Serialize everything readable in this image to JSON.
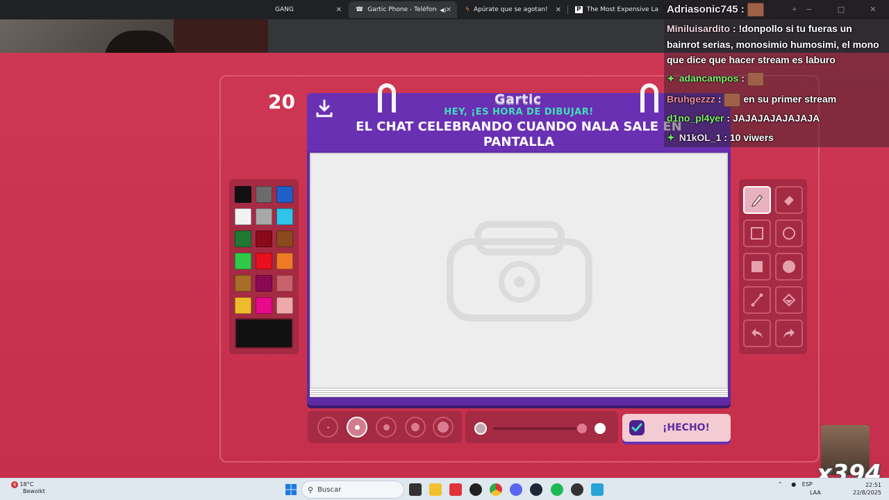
{
  "browser": {
    "tabs": [
      {
        "label": "GANG",
        "icon": "tab-favicon"
      },
      {
        "label": "Gartic Phone - Teléfono De",
        "icon": "phone-icon",
        "audio": true
      },
      {
        "label": "Apúrate que se agotan!",
        "icon": "lightning-icon"
      },
      {
        "label": "The Most Expensive Labubu Di",
        "icon": "p-icon"
      }
    ],
    "new_tab": "+",
    "window": {
      "minimize": "−",
      "maximize": "□",
      "close": "✕"
    }
  },
  "game": {
    "timer": "20",
    "logo_text": "Gartic",
    "subtitle": "HEY, ¡ES HORA DE DIBUJAR!",
    "prompt": "EL CHAT CELEBRANDO CUANDO NALA SALE EN PANTALLA",
    "done_label": "¡HECHO!",
    "palette": [
      "#111111",
      "#6b6b6b",
      "#1e5fc9",
      "#f2f2f2",
      "#a8a8a8",
      "#2fc4e8",
      "#1e7a33",
      "#8a0a1a",
      "#8a4a1e",
      "#2fc94a",
      "#e8101e",
      "#ee7a26",
      "#a86d28",
      "#8a0a52",
      "#c7626b",
      "#eebb2c",
      "#e80a8a",
      "#eea8a8"
    ],
    "current_color": "#111111",
    "tools": [
      "pencil-icon",
      "eraser-icon",
      "rectangle-icon",
      "ellipse-icon",
      "filled-rectangle-icon",
      "filled-ellipse-icon",
      "line-icon",
      "fill-bucket-icon",
      "undo-icon",
      "redo-icon"
    ],
    "selected_tool": "pencil-icon",
    "selected_brush_size": 2
  },
  "chat": {
    "messages": [
      {
        "user": "Adriasonic745",
        "text": ""
      },
      {
        "user": "Miniluisardito",
        "text": "!donpollo si tu fueras un"
      },
      {
        "user": "",
        "text": "bainrot serias, monosimio humosimi, el mono"
      },
      {
        "user": "",
        "text": "que dice que hacer stream es laburo"
      },
      {
        "user": "adancampos",
        "text": ""
      },
      {
        "user": "Bruhgezzz",
        "text": "en su primer stream"
      },
      {
        "user": "d1no_pl4yer",
        "text": "JAJAJAJAJAJAJA"
      },
      {
        "user": "N1kOL_1",
        "text": "10 viwers"
      }
    ]
  },
  "overlay": {
    "counter": "x394"
  },
  "taskbar": {
    "weather_badge": "4",
    "temperature": "18°C",
    "weather_text": "Bewolkt",
    "search_placeholder": "Buscar",
    "language": "ESP",
    "language_sub": "LAA",
    "time": "22:51",
    "date": "22/8/2025"
  }
}
